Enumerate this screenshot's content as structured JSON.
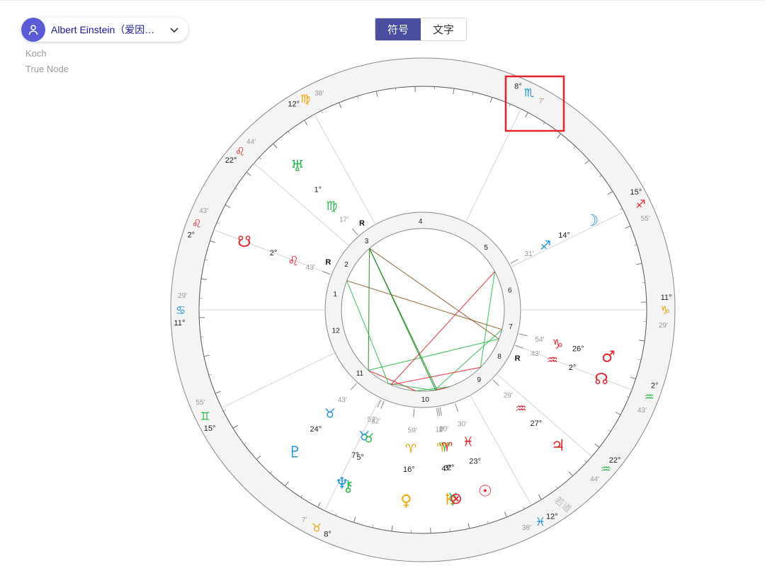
{
  "header": {
    "person_name": "Albert Einstein（爱因…",
    "house_system": "Koch",
    "node_type": "True Node",
    "view_toggle": [
      "符号",
      "文字"
    ]
  },
  "colors": {
    "fire": "#e8232a",
    "earth": "#f0a500",
    "air": "#2cb84e",
    "water": "#1e90e0",
    "toggle_active": "#4b4d9e",
    "highlight_box": "#e8232a",
    "ring": "#f4f4f4"
  },
  "chart": {
    "ascendant_deg": 102,
    "sign_glyphs": [
      "♈",
      "♉",
      "♊",
      "♋",
      "♌",
      "♍",
      "♎",
      "♏",
      "♐",
      "♑",
      "♒",
      "♓"
    ],
    "house_cusps": [
      {
        "deg": "11°",
        "sign": "♋",
        "min": "29′",
        "el": "water"
      },
      {
        "deg": "2°",
        "sign": "♌",
        "min": "43′",
        "el": "fire"
      },
      {
        "deg": "22°",
        "sign": "♌",
        "min": "44′",
        "el": "fire"
      },
      {
        "deg": "12°",
        "sign": "♍",
        "min": "38′",
        "el": "earth"
      },
      {
        "deg": "8°",
        "sign": "♏",
        "min": "7′",
        "el": "water"
      },
      {
        "deg": "15°",
        "sign": "♐",
        "min": "55′",
        "el": "fire"
      },
      {
        "deg": "11°",
        "sign": "♑",
        "min": "29′",
        "el": "earth"
      },
      {
        "deg": "2°",
        "sign": "♒",
        "min": "43′",
        "el": "air"
      },
      {
        "deg": "22°",
        "sign": "♒",
        "min": "44′",
        "el": "air"
      },
      {
        "deg": "12°",
        "sign": "♓",
        "min": "38′",
        "el": "water"
      },
      {
        "deg": "8°",
        "sign": "♉",
        "min": "7′",
        "el": "earth"
      },
      {
        "deg": "15°",
        "sign": "♊",
        "min": "55′",
        "el": "air"
      }
    ],
    "planets": [
      {
        "name": "sun",
        "glyph": "☉",
        "deg": "23°",
        "sign": "♓",
        "min": "30′",
        "el": "fire",
        "retro": ""
      },
      {
        "name": "moon",
        "glyph": "☽",
        "deg": "14°",
        "sign": "♐",
        "min": "31′",
        "el": "water",
        "retro": ""
      },
      {
        "name": "mercury",
        "glyph": "☿",
        "deg": "3°",
        "sign": "♈",
        "min": "8′",
        "el": "air",
        "retro": ""
      },
      {
        "name": "venus",
        "glyph": "♀",
        "deg": "16°",
        "sign": "♈",
        "min": "59′",
        "el": "earth",
        "retro": ""
      },
      {
        "name": "mars",
        "glyph": "♂",
        "deg": "26°",
        "sign": "♑",
        "min": "54′",
        "el": "fire",
        "retro": ""
      },
      {
        "name": "jupiter",
        "glyph": "♃",
        "deg": "27°",
        "sign": "♒",
        "min": "29′",
        "el": "fire",
        "retro": ""
      },
      {
        "name": "saturn",
        "glyph": "♄",
        "deg": "4°",
        "sign": "♈",
        "min": "11′",
        "el": "earth",
        "retro": ""
      },
      {
        "name": "uranus",
        "glyph": "♅",
        "deg": "1°",
        "sign": "♍",
        "min": "17′",
        "el": "air",
        "retro": "R"
      },
      {
        "name": "neptune",
        "glyph": "♆",
        "deg": "7°",
        "sign": "♉",
        "min": "52′",
        "el": "water",
        "retro": ""
      },
      {
        "name": "pluto",
        "glyph": "♇",
        "deg": "24°",
        "sign": "♉",
        "min": "43′",
        "el": "water",
        "retro": ""
      },
      {
        "name": "chiron",
        "glyph": "⚷",
        "deg": "5°",
        "sign": "♉",
        "min": "32′",
        "el": "air",
        "retro": ""
      },
      {
        "name": "north-node",
        "glyph": "☊",
        "deg": "2°",
        "sign": "♒",
        "min": "43′",
        "el": "fire",
        "retro": "R"
      },
      {
        "name": "south-node",
        "glyph": "☋",
        "deg": "2°",
        "sign": "♌",
        "min": "43′",
        "el": "fire",
        "retro": "R"
      },
      {
        "name": "part-of-fortune",
        "glyph": "⊗",
        "deg": "2°",
        "sign": "♈",
        "min": "30′",
        "el": "fire",
        "retro": ""
      }
    ],
    "house_numbers": [
      "1",
      "2",
      "3",
      "4",
      "5",
      "6",
      "7",
      "8",
      "9",
      "10",
      "11",
      "12"
    ],
    "corner_label": "若道"
  }
}
